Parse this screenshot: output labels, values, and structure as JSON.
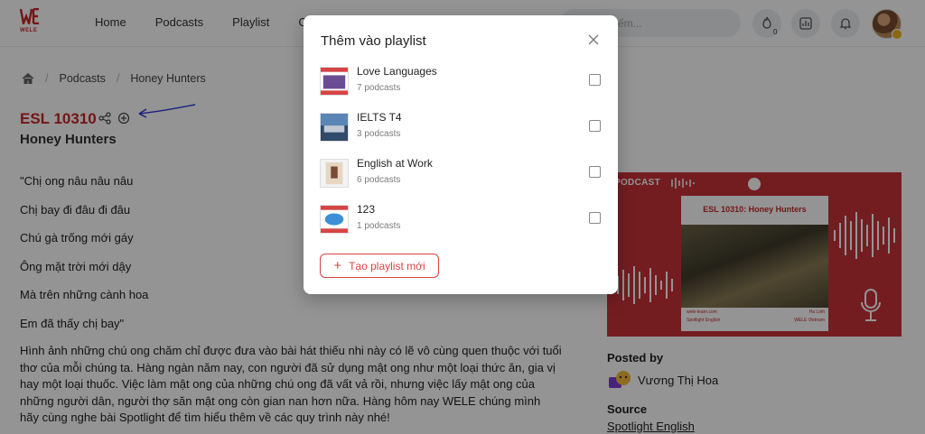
{
  "header": {
    "logo_text": "WELE",
    "nav": [
      "Home",
      "Podcasts",
      "Playlist",
      "Cla"
    ],
    "search_placeholder": "ếm...",
    "fire_count": "0"
  },
  "breadcrumb": [
    "Podcasts",
    "Honey Hunters"
  ],
  "episode": {
    "title": "ESL 10310",
    "subtitle": "Honey Hunters",
    "lyrics": [
      "\"Chị ong nâu nâu nâu",
      "Chị bay đi đâu đi đâu",
      "Chú gà trống mới gáy",
      "Ông mặt trời mới dậy",
      "Mà trên những cành hoa",
      "Em đã thấy chị bay\""
    ],
    "description": "Hình ảnh những chú ong chăm chỉ được đưa vào bài hát thiếu nhi này có lẽ vô cùng quen thuộc với tuổi thơ của mỗi chúng ta. Hàng ngàn năm nay, con người đã sử dụng mật ong như một loại thức ăn, gia vị hay một loại thuốc. Việc làm mật ong của những chú ong đã vất vả rồi, nhưng việc lấy mật ong của những người dân, người thợ săn mật ong còn gian nan hơn nữa. Hàng hôm nay WELE chúng mình hãy cùng nghe bài Spotlight để tìm hiểu thêm về các quy trình này nhé!"
  },
  "cover": {
    "label": "PODCAST",
    "title": "ESL 10310: Honey Hunters",
    "footer_left": [
      "wele-learn.com",
      "Spotlight English"
    ],
    "footer_right": [
      "Ha Linh",
      "WELE Vietnam"
    ]
  },
  "sidebar": {
    "posted_by_label": "Posted by",
    "posted_by": "Vương Thị Hoa",
    "source_label": "Source",
    "source": "Spotlight English"
  },
  "modal": {
    "title": "Thêm vào playlist",
    "playlists": [
      {
        "name": "Love Languages",
        "count": "7 podcasts",
        "checked": false
      },
      {
        "name": "IELTS T4",
        "count": "3 podcasts",
        "checked": false
      },
      {
        "name": "English at Work",
        "count": "6 podcasts",
        "checked": false
      },
      {
        "name": "123",
        "count": "1 podcasts",
        "checked": false
      }
    ],
    "new_playlist_label": "Tạo playlist mới"
  },
  "colors": {
    "brand_red": "#c62828",
    "accent_red": "#d64545",
    "cover_red": "#c8323a"
  }
}
